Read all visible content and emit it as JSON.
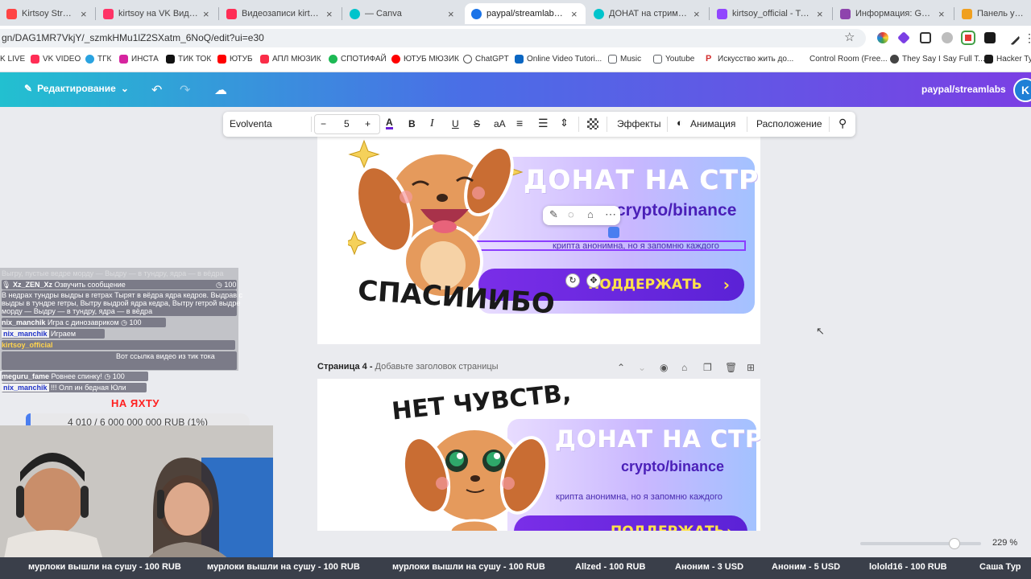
{
  "browser": {
    "tabs": [
      {
        "title": "Kirtsoy Stream - Watch f",
        "favicon_color": "#ff4444"
      },
      {
        "title": "kirtsoy на VK Видео Live",
        "favicon_color": "#ff3366"
      },
      {
        "title": "Видеозаписи kirtsoy",
        "favicon_color": "#ff2d55"
      },
      {
        "title": "— Canva",
        "favicon_color": "#00c4cc"
      },
      {
        "title": "paypal/streamlabs — 32",
        "favicon_color": "#1a73e8"
      },
      {
        "title": "ДОНАТ на стрим — Mu",
        "favicon_color": "#00c4cc"
      },
      {
        "title": "kirtsoy_official - Twitch",
        "favicon_color": "#9146ff"
      },
      {
        "title": "Информация: GRUZ — K",
        "favicon_color": "#8e44ad"
      },
      {
        "title": "Панель управле",
        "favicon_color": "#f0a020"
      }
    ],
    "url": "gn/DAG1MR7VkjY/_szmkHMu1lZ2SXatm_6NoQ/edit?ui=e30",
    "bookmarks": [
      {
        "label": "K LIVE",
        "color": "#ff3366"
      },
      {
        "label": "VK VIDEO",
        "color": "#ff2d55"
      },
      {
        "label": "ТГК",
        "color": "#2aa3e0"
      },
      {
        "label": "ИНСТА",
        "color": "#d6249f"
      },
      {
        "label": "ТИК ТОК",
        "color": "#111111"
      },
      {
        "label": "ЮТУБ",
        "color": "#ff0000"
      },
      {
        "label": "АПЛ МЮЗИК",
        "color": "#fa2d48"
      },
      {
        "label": "СПОТИФАЙ",
        "color": "#1db954"
      },
      {
        "label": "ЮТУБ МЮЗИК",
        "color": "#ff0000"
      },
      {
        "label": "ChatGPT",
        "color": "#555555"
      },
      {
        "label": "Online Video Tutori...",
        "color": "#0a66c2"
      },
      {
        "label": "Music",
        "color": "#5f6368"
      },
      {
        "label": "Youtube",
        "color": "#5f6368"
      },
      {
        "label": "Искусство жить до...",
        "color": "#d32f2f"
      },
      {
        "label": "Control Room (Free...",
        "color": "#cccccc"
      },
      {
        "label": "They Say I Say Full T...",
        "color": "#444444"
      },
      {
        "label": "Hacker Typ",
        "color": "#1a1a1a"
      }
    ]
  },
  "canva": {
    "edit_label": "Редактирование",
    "doc_title": "paypal/streamlabs",
    "avatar_letter": "K",
    "brand_gradient": [
      "#22c0d0",
      "#4a6ee6",
      "#7b3fe4"
    ]
  },
  "toolbar": {
    "font": "Evolventa",
    "size": "5",
    "minus": "−",
    "plus": "+",
    "case_label": "aA",
    "effects": "Эффекты",
    "animation": "Анимация",
    "position": "Расположение"
  },
  "page3": {
    "headline": "ДОНАТ НА СТРИМ",
    "crypto": "crypto/binance",
    "caption": "крипта анонимна, но я запомню каждого",
    "button": "ПОДДЕРЖАТЬ",
    "sticker_text": "СПАСИИИБО"
  },
  "page4": {
    "heading_label": "Страница 4 -",
    "heading_placeholder": "Добавьте заголовок страницы",
    "headline": "ДОНАТ НА СТРИМ",
    "crypto": "crypto/binance",
    "caption": "крипта анонимна, но я запомню каждого",
    "button": "ПОДДЕРЖАТЬ",
    "sticker_text": "НЕТ ЧУВСТВ,"
  },
  "stream": {
    "chat": [
      {
        "nick": "",
        "text": "Выгру, пустые ведре морду — Выдру — в тундру, ядра — в вёдра"
      },
      {
        "nick": "Xz_ZEN_Xz",
        "text": "Озвучить сообщение",
        "cost": "100"
      },
      {
        "nick": "",
        "text": "В недрах тундры выдры в гетрах Тырят в вёдра ядра кедров. Выдрав с"
      },
      {
        "nick": "",
        "text": "выдры в тундре гетры, Вытру выдрой ядра кедра, Вытру гетрой выдре"
      },
      {
        "nick": "",
        "text": "морду — Выдру — в тундру, ядра — в вёдра"
      },
      {
        "nick": "nix_manchik",
        "text": "Игра с динозавриком",
        "cost": "100"
      },
      {
        "nick": "nix_manchik",
        "text": "Играем"
      },
      {
        "nick": "kirtsoy_official",
        "text": ""
      },
      {
        "nick": "",
        "text": "Вот ссылка видео из тик тока"
      },
      {
        "nick": "meguru_fame",
        "text": "Ровнее спинку!",
        "cost": "100"
      },
      {
        "nick": "nix_manchik",
        "text": "!!! Олп ин бедная Юли"
      }
    ],
    "goal_title": "НА ЯХТУ",
    "goal_text": "4 010 / 6 000 000 000 RUB (1%)",
    "goal_fraction": 0.01
  },
  "zoom": {
    "label": "229 %",
    "fraction": 0.78
  },
  "ticker": [
    "мурлоки вышли на сушу - 100 RUB",
    "мурлоки вышли на сушу - 100 RUB",
    "мурлоки вышли на сушу - 100 RUB",
    "Allzed - 100 RUB",
    "Аноним - 3 USD",
    "Аноним - 5 USD",
    "lolold16 - 100 RUB",
    "Саша Тур"
  ]
}
